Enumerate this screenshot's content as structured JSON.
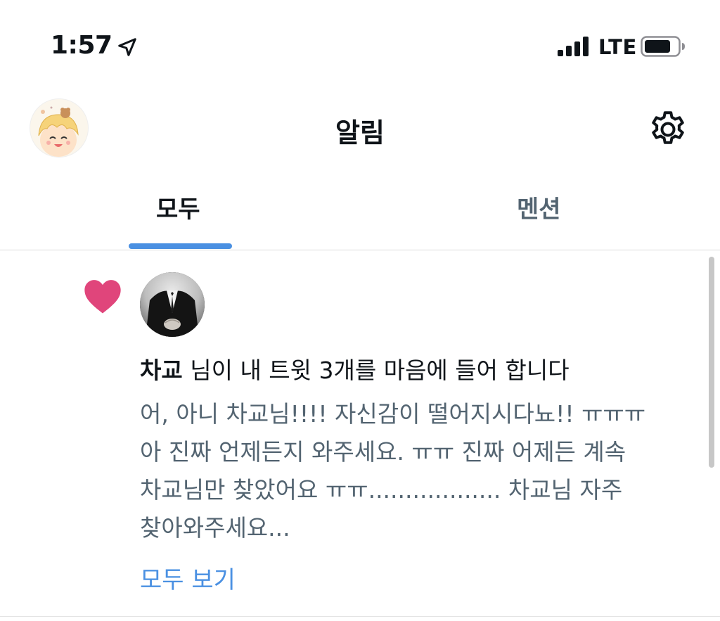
{
  "status_bar": {
    "time": "1:57",
    "network": "LTE",
    "icons": [
      "location-arrow-icon",
      "signal-bars-icon",
      "battery-icon"
    ]
  },
  "header": {
    "title": "알림",
    "settings_icon": "gear-icon"
  },
  "tabs": [
    {
      "label": "모두",
      "active": true
    },
    {
      "label": "멘션",
      "active": false
    }
  ],
  "notification": {
    "type_icon": "heart-icon",
    "user_name": "차교",
    "action_text": "님이 내 트윗 3개를 마음에 들어 합니다",
    "preview_lines": [
      "어, 아니 차교님!!!! 자신감이 떨어지시다뇨!! ㅠㅠㅠ",
      "아 진짜 언제든지 와주세요. ㅠㅠ 진짜 어제든 계속",
      "차교님만 찾았어요 ㅠㅠ.................. 차교님 자주",
      "찾아와주세요..."
    ],
    "see_all_label": "모두 보기"
  },
  "colors": {
    "accent": "#4a90e2",
    "heart": "#e0457b",
    "text_primary": "#0f1419",
    "text_secondary": "#536471"
  }
}
